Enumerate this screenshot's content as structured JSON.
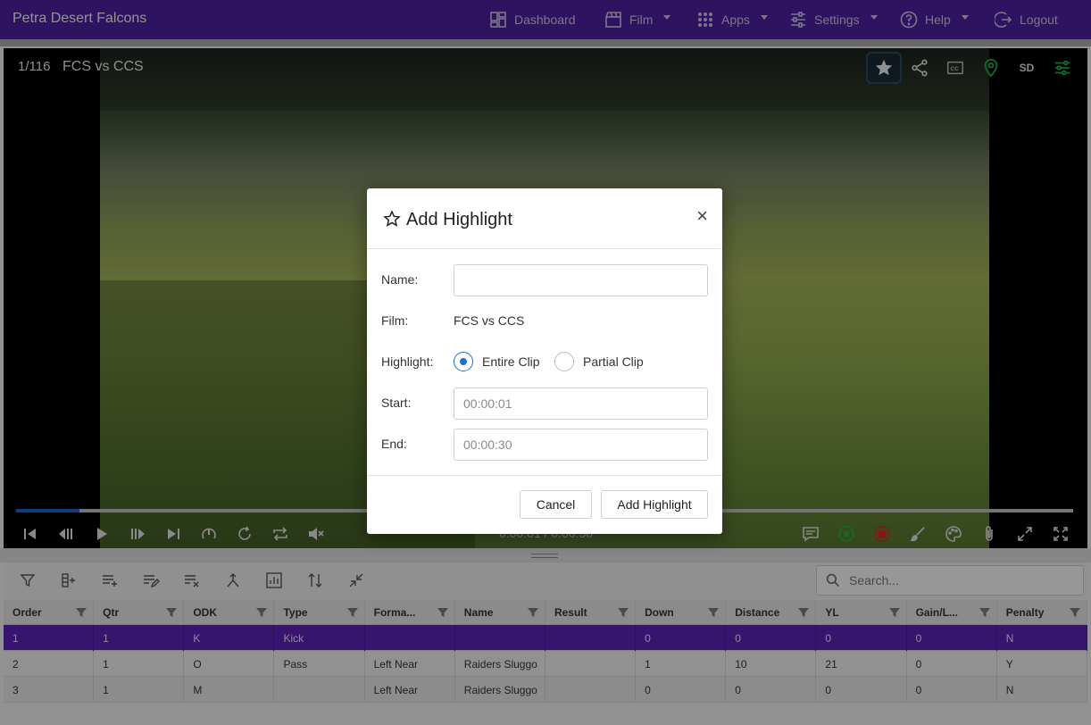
{
  "navbar": {
    "brand": "Petra Desert Falcons",
    "items": [
      {
        "label": "Dashboard",
        "icon": "dashboard-icon",
        "caret": false
      },
      {
        "label": "Film",
        "icon": "film-icon",
        "caret": true
      },
      {
        "label": "Apps",
        "icon": "apps-grid-icon",
        "caret": true
      },
      {
        "label": "Settings",
        "icon": "sliders-icon",
        "caret": true
      },
      {
        "label": "Help",
        "icon": "help-icon",
        "caret": true
      },
      {
        "label": "Logout",
        "icon": "logout-icon",
        "caret": false
      }
    ]
  },
  "video": {
    "counter": "1/116",
    "title": "FCS vs CCS",
    "quality": "SD",
    "time_readout": "0:00:01 / 0:00:30",
    "progress": 0.06,
    "top_icons": [
      "star-icon",
      "share-icon",
      "closed-caption-icon",
      "location-pin-icon",
      "sd-quality-label",
      "adjust-sliders-icon"
    ]
  },
  "grid": {
    "search_placeholder": "Search...",
    "columns": [
      "Order",
      "Qtr",
      "ODK",
      "Type",
      "Forma...",
      "Name",
      "Result",
      "Down",
      "Distance",
      "YL",
      "Gain/L...",
      "Penalty"
    ],
    "rows": [
      {
        "cells": [
          "1",
          "1",
          "K",
          "Kick",
          "",
          "",
          "",
          "0",
          "0",
          "0",
          "0",
          "N"
        ],
        "selected": true
      },
      {
        "cells": [
          "2",
          "1",
          "O",
          "Pass",
          "Left Near",
          "Raiders Sluggo",
          "",
          "1",
          "10",
          "21",
          "0",
          "Y"
        ],
        "selected": false
      },
      {
        "cells": [
          "3",
          "1",
          "M",
          "",
          "Left Near",
          "Raiders Sluggo",
          "",
          "0",
          "0",
          "0",
          "0",
          "N"
        ],
        "selected": false
      }
    ]
  },
  "modal": {
    "title": "Add Highlight",
    "close": "×",
    "name_label": "Name:",
    "name_value": "",
    "film_label": "Film:",
    "film_value": "FCS vs CCS",
    "highlight_label": "Highlight:",
    "option_entire": "Entire Clip",
    "option_partial": "Partial Clip",
    "selected_option": "Entire Clip",
    "start_label": "Start:",
    "start_value": "00:00:01",
    "end_label": "End:",
    "end_value": "00:00:30",
    "cancel_label": "Cancel",
    "submit_label": "Add Highlight"
  },
  "colors": {
    "nav_bg": "#4b1f9c",
    "selected_row": "#5a22b4",
    "progress": "#1e63c8",
    "radio_accent": "#1a73c9",
    "green_icon": "#22aa44",
    "red_icon": "#dd2222"
  }
}
